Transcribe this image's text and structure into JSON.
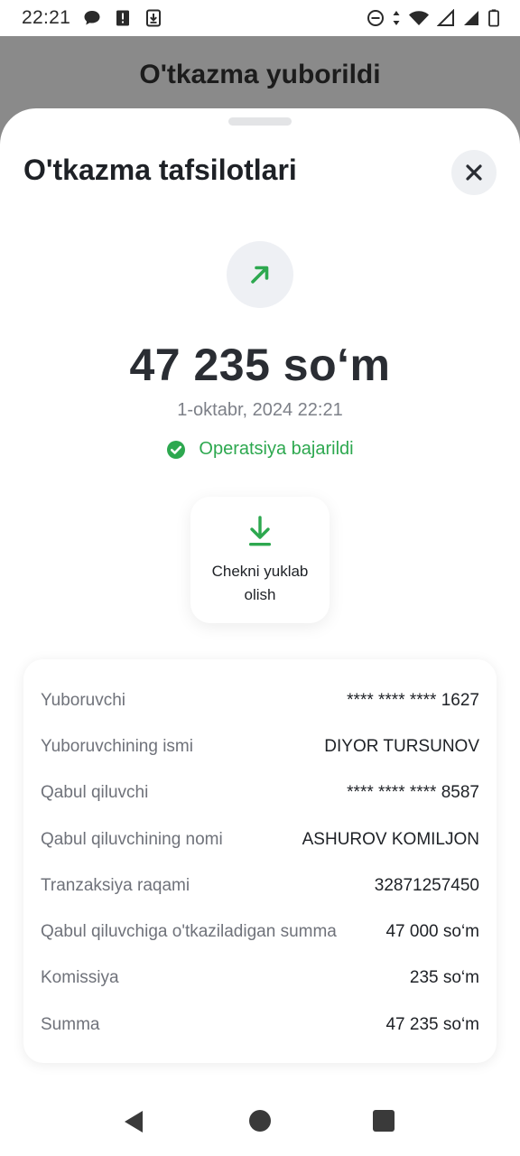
{
  "status_bar": {
    "time": "22:21",
    "left_icons": [
      "chat-bubble-icon",
      "alert-icon",
      "download-notification-icon"
    ],
    "right_icons": [
      "do-not-disturb-icon",
      "data-arrows-icon",
      "wifi-icon",
      "signal-icon",
      "signal-full-icon",
      "battery-icon"
    ]
  },
  "backdrop": {
    "title": "O'tkazma yuborildi"
  },
  "sheet": {
    "title": "O'tkazma tafsilotlari",
    "close_icon": "close-icon",
    "direction_icon": "arrow-up-right-icon",
    "amount": "47 235 so‘m",
    "datetime": "1-oktabr, 2024 22:21",
    "status_text": "Operatsiya bajarildi",
    "status_icon": "check-circle-icon",
    "download": {
      "icon": "download-icon",
      "label": "Chekni yuklab olish"
    },
    "details": [
      {
        "label": "Yuboruvchi",
        "value": "**** **** **** 1627"
      },
      {
        "label": "Yuboruvchining ismi",
        "value": "DIYOR TURSUNOV"
      },
      {
        "label": "Qabul qiluvchi",
        "value": "**** **** **** 8587"
      },
      {
        "label": "Qabul qiluvchining nomi",
        "value": "ASHUROV KOMILJON"
      },
      {
        "label": "Tranzaksiya raqami",
        "value": "32871257450"
      },
      {
        "label": "Qabul qiluvchiga o'tkaziladigan summa",
        "value": "47 000 so‘m"
      },
      {
        "label": "Komissiya",
        "value": "235 so‘m"
      },
      {
        "label": "Summa",
        "value": "47 235 so‘m"
      }
    ]
  },
  "colors": {
    "accent_green": "#2da84f",
    "backdrop": "#8a8a8a"
  }
}
